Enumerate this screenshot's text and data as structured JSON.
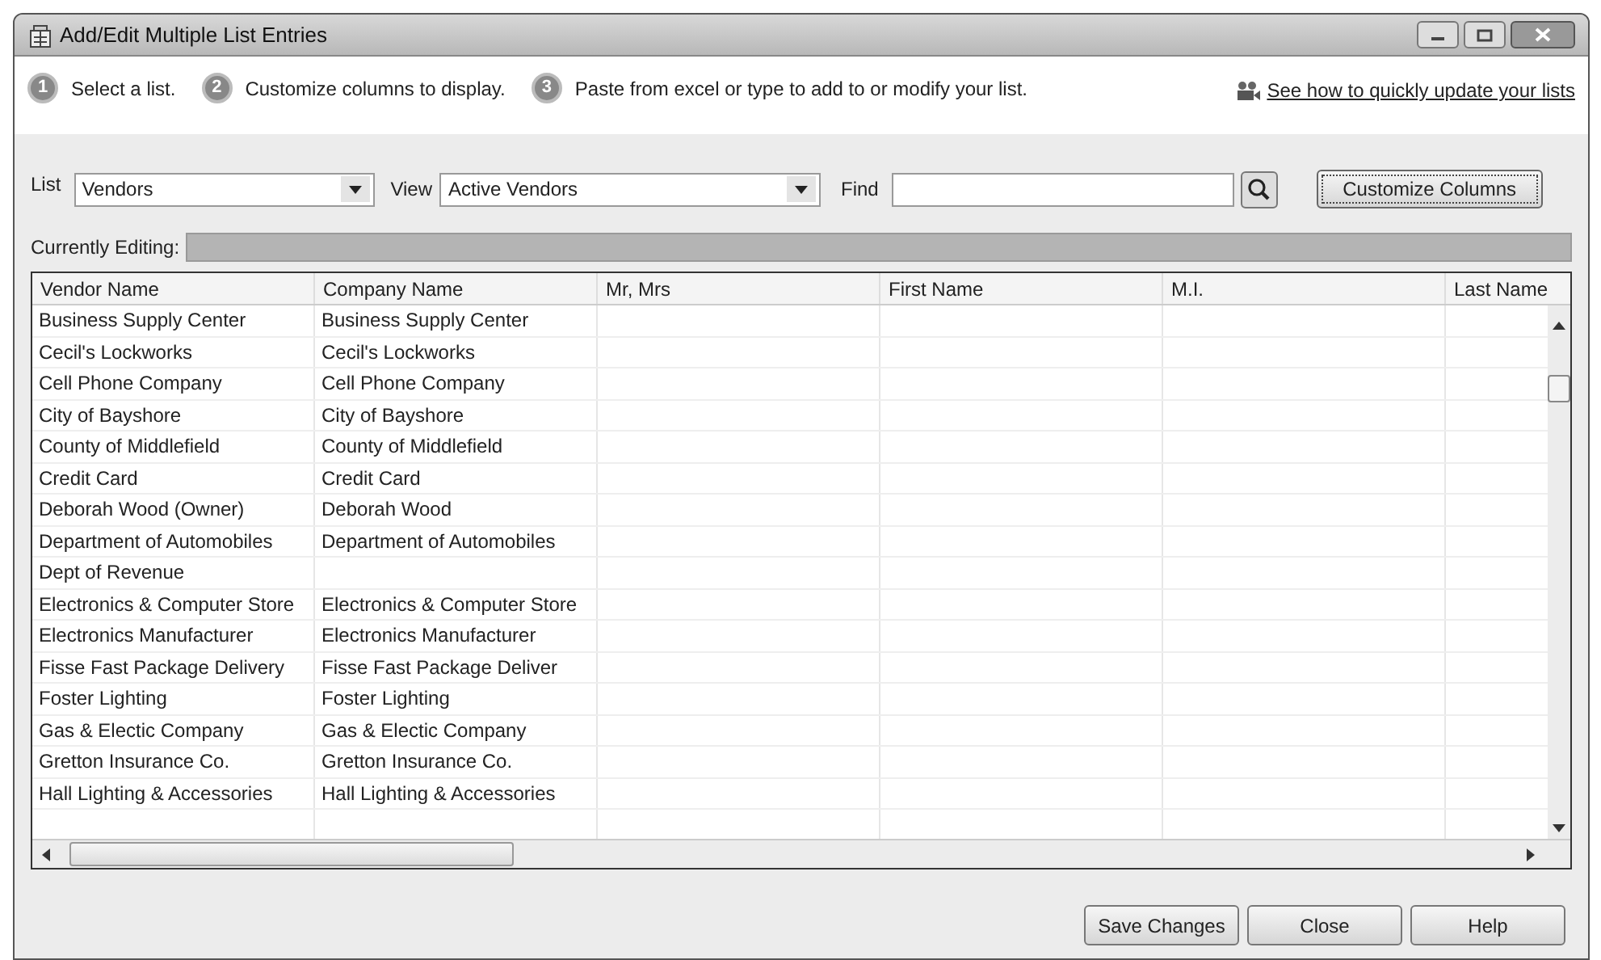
{
  "window": {
    "title": "Add/Edit Multiple List Entries"
  },
  "steps": [
    {
      "number": "1",
      "text": "Select a list."
    },
    {
      "number": "2",
      "text": "Customize columns to display."
    },
    {
      "number": "3",
      "text": "Paste from excel or type to add to or modify your list."
    }
  ],
  "help_link": "See how to quickly update your lists",
  "list_field": {
    "label": "List",
    "value": "Vendors"
  },
  "view_field": {
    "label": "View",
    "value": "Active Vendors"
  },
  "find_field": {
    "label": "Find"
  },
  "customize_button": "Customize Columns",
  "currently_editing": {
    "label": "Currently Editing:"
  },
  "table": {
    "columns": [
      "Vendor Name",
      "Company Name",
      "Mr, Mrs",
      "First Name",
      "M.I.",
      "Last Name"
    ],
    "rows": [
      {
        "vendor_name": "Business Supply Center",
        "company_name": "Business Supply Center"
      },
      {
        "vendor_name": "Cecil's Lockworks",
        "company_name": "Cecil's Lockworks"
      },
      {
        "vendor_name": "Cell Phone Company",
        "company_name": "Cell Phone Company"
      },
      {
        "vendor_name": "City of Bayshore",
        "company_name": "City of Bayshore"
      },
      {
        "vendor_name": "County of Middlefield",
        "company_name": "County of Middlefield"
      },
      {
        "vendor_name": "Credit Card",
        "company_name": "Credit Card"
      },
      {
        "vendor_name": "Deborah Wood (Owner)",
        "company_name": "Deborah Wood"
      },
      {
        "vendor_name": "Department of Automobiles",
        "company_name": "Department of Automobiles"
      },
      {
        "vendor_name": "Dept of Revenue"
      },
      {
        "vendor_name": "Electronics & Computer Store",
        "company_name": "Electronics & Computer Store"
      },
      {
        "vendor_name": "Electronics Manufacturer",
        "company_name": "Electronics Manufacturer"
      },
      {
        "vendor_name": "Fisse Fast Package Delivery",
        "company_name": "Fisse Fast Package Deliver"
      },
      {
        "vendor_name": "Foster Lighting",
        "company_name": "Foster Lighting"
      },
      {
        "vendor_name": "Gas & Electic Company",
        "company_name": "Gas & Electic Company"
      },
      {
        "vendor_name": "Gretton Insurance Co.",
        "company_name": "Gretton Insurance Co."
      },
      {
        "vendor_name": "Hall Lighting & Accessories",
        "company_name": "Hall Lighting & Accessories"
      }
    ]
  },
  "buttons": [
    "Save Changes",
    "Close",
    "Help"
  ]
}
